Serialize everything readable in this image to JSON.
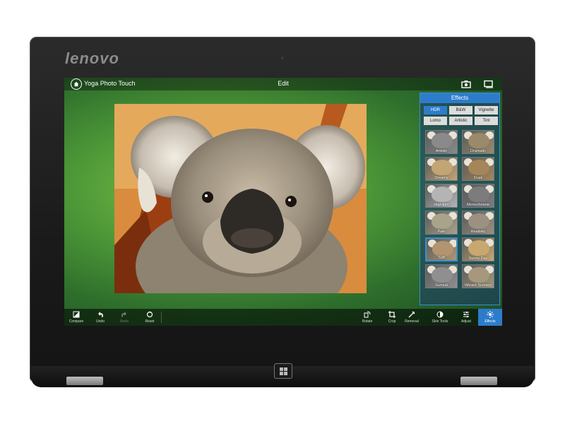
{
  "device": {
    "brand": "lenovo"
  },
  "app": {
    "title": "Yoga Photo Touch",
    "mode": "Edit"
  },
  "effects_panel": {
    "header": "Effects",
    "tabs": [
      {
        "label": "HDR",
        "active": true
      },
      {
        "label": "B&W",
        "active": false
      },
      {
        "label": "Vignette",
        "active": false
      },
      {
        "label": "Lomo",
        "active": false
      },
      {
        "label": "Artistic",
        "active": false
      },
      {
        "label": "Tint",
        "active": false
      }
    ],
    "presets": [
      {
        "label": "Artistic",
        "tone": "#8a8a8a"
      },
      {
        "label": "Dramatic",
        "tone": "#9a8a6a"
      },
      {
        "label": "Dreamy",
        "tone": "#c2a574"
      },
      {
        "label": "Dusk",
        "tone": "#a5865a"
      },
      {
        "label": "Highlight",
        "tone": "#b4b4b4"
      },
      {
        "label": "Monochrome",
        "tone": "#7c7c7c"
      },
      {
        "label": "Pale",
        "tone": "#a8a38a"
      },
      {
        "label": "Realistic",
        "tone": "#9c9080"
      },
      {
        "label": "Soft",
        "tone": "#b09570"
      },
      {
        "label": "Sunny Day",
        "tone": "#c9a870"
      },
      {
        "label": "Surreal",
        "tone": "#8f8f8f"
      },
      {
        "label": "Vibrant Scenery",
        "tone": "#a6987c"
      }
    ],
    "selected_preset": "Soft"
  },
  "toolbar_left": [
    {
      "label": "Compare",
      "icon": "compare-icon",
      "enabled": true
    },
    {
      "label": "Undo",
      "icon": "undo-icon",
      "enabled": true
    },
    {
      "label": "Redo",
      "icon": "redo-icon",
      "enabled": false
    },
    {
      "label": "Reset",
      "icon": "reset-icon",
      "enabled": true
    }
  ],
  "toolbar_right": [
    {
      "label": "Rotate",
      "icon": "rotate-icon"
    },
    {
      "label": "Crop",
      "icon": "crop-icon"
    },
    {
      "label": "Removal",
      "icon": "removal-icon"
    },
    {
      "label": "Skin Tools",
      "icon": "skin-tools-icon"
    },
    {
      "label": "Adjust",
      "icon": "adjust-icon"
    },
    {
      "label": "Effects",
      "icon": "effects-icon",
      "active": true
    }
  ],
  "colors": {
    "accent": "#2d7ccc",
    "panel_border": "#3b8ed4"
  }
}
